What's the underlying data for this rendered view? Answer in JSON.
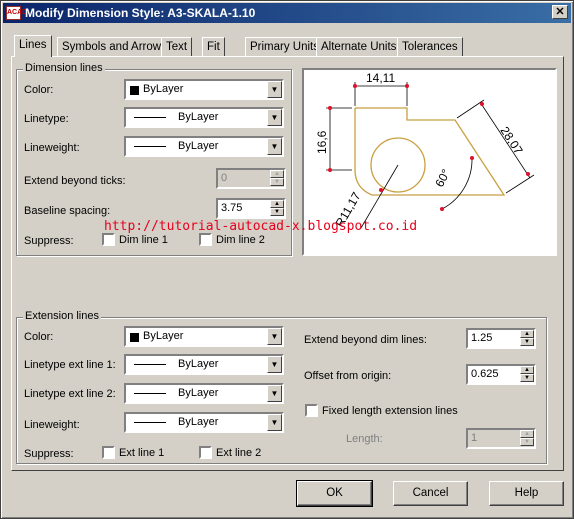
{
  "window": {
    "title": "Modify Dimension Style: A3-SKALA-1.10",
    "icon_text": "ACAD",
    "close_glyph": "✕"
  },
  "tabs": [
    "Lines",
    "Symbols and Arrows",
    "Text",
    "Fit",
    "Primary Units",
    "Alternate Units",
    "Tolerances"
  ],
  "dimension_lines": {
    "legend": "Dimension lines",
    "color_label": "Color:",
    "color_value": "ByLayer",
    "linetype_label": "Linetype:",
    "linetype_value": "ByLayer",
    "lineweight_label": "Lineweight:",
    "lineweight_value": "ByLayer",
    "extend_label": "Extend beyond ticks:",
    "extend_value": "0",
    "baseline_label": "Baseline spacing:",
    "baseline_value": "3.75",
    "suppress_label": "Suppress:",
    "dim1_label": "Dim line 1",
    "dim2_label": "Dim line 2",
    "dim1_checked": false,
    "dim2_checked": false
  },
  "extension_lines": {
    "legend": "Extension lines",
    "color_label": "Color:",
    "color_value": "ByLayer",
    "lt1_label": "Linetype ext line 1:",
    "lt1_value": "ByLayer",
    "lt2_label": "Linetype ext line 2:",
    "lt2_value": "ByLayer",
    "lineweight_label": "Lineweight:",
    "lineweight_value": "ByLayer",
    "suppress_label": "Suppress:",
    "ext1_label": "Ext line 1",
    "ext2_label": "Ext line 2",
    "extend_dim_label": "Extend beyond dim lines:",
    "extend_dim_value": "1.25",
    "offset_label": "Offset from origin:",
    "offset_value": "0.625",
    "fixed_label": "Fixed length extension lines",
    "length_label": "Length:",
    "length_value": "1"
  },
  "preview": {
    "dim_top": "14,11",
    "dim_left": "16,6",
    "dim_right": "28,07",
    "dim_radius": "R11,17",
    "dim_angle": "60°"
  },
  "watermark": "http://tutorial-autocad-x.blogspot.co.id",
  "buttons": {
    "ok": "OK",
    "cancel": "Cancel",
    "help": "Help"
  },
  "colors": {
    "title_start": "#0a246a",
    "title_end": "#3a6ea5",
    "dialog_bg": "#d4d0c8",
    "geometry": "#c8a040",
    "dim_lines": "#000000",
    "arrow_marks": "#e0102c",
    "watermark": "#e8001c"
  }
}
